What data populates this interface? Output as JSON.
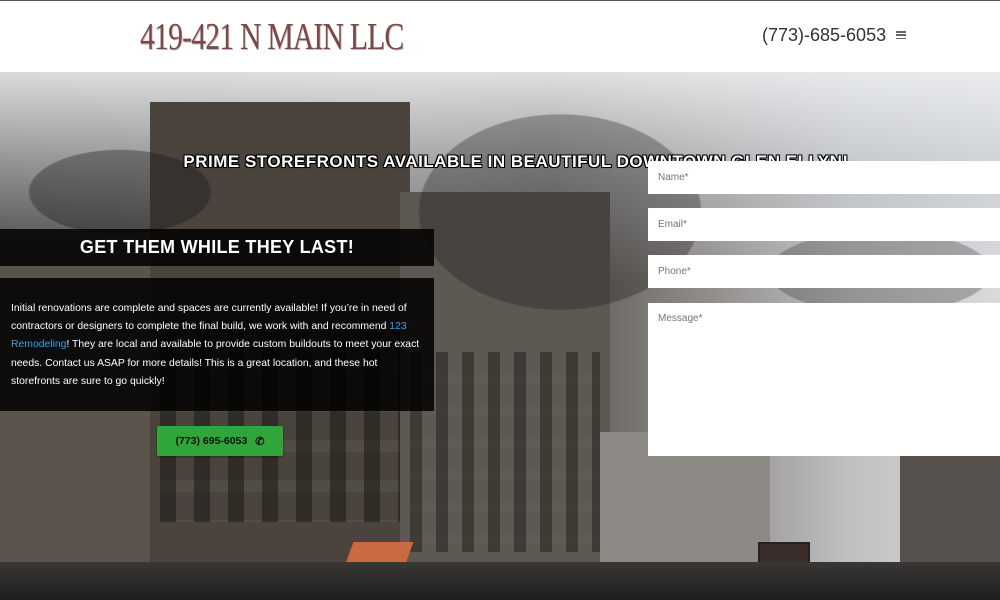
{
  "header": {
    "logo": "419-421 N MAIN LLC",
    "phone": "(773)-685-6053",
    "menu_icon": "hamburger-icon"
  },
  "hero": {
    "headline": "PRIME STOREFRONTS AVAILABLE IN BEAUTIFUL DOWNTOWN GLEN ELLYN!",
    "tagline": "GET THEM WHILE THEY LAST!",
    "body_part1": "Initial renovations are complete and spaces are currently available! If you’re in need of contractors or designers to complete the final build, we work with and recommend ",
    "body_link": "123 Remodeling",
    "body_part2": "! They are local and available to provide custom buildouts to meet your exact needs. Contact us ASAP for more details! This is a great location, and these hot storefronts are sure to go quickly!",
    "call_button": "(773) 695-6053",
    "call_icon": "phone-icon"
  },
  "form": {
    "name_placeholder": "Name*",
    "email_placeholder": "Email*",
    "phone_placeholder": "Phone*",
    "message_placeholder": "Message*"
  },
  "colors": {
    "accent_green": "#2fa53a",
    "link_blue": "#3b9fe8",
    "logo": "#7a4a4a"
  }
}
